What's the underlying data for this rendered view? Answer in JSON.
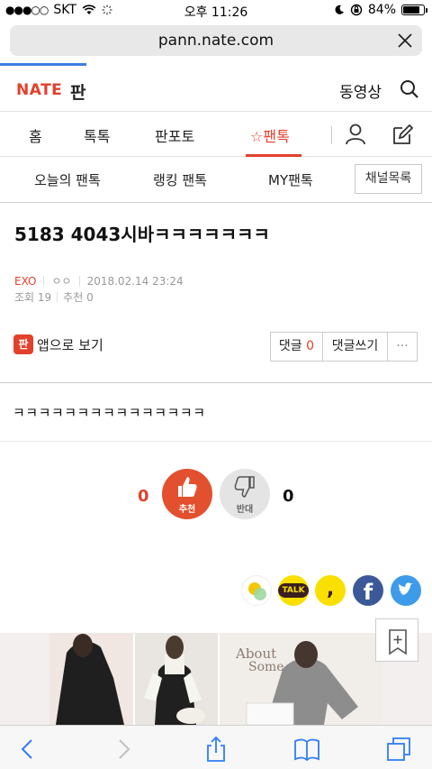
{
  "status": {
    "carrier": "SKT",
    "time": "오후 11:26",
    "battery": "84%",
    "battery_level": 0.84
  },
  "browser": {
    "url": "pann.nate.com",
    "load_progress": 0.2
  },
  "header": {
    "logo": "NATE",
    "section": "판",
    "video": "동영상"
  },
  "nav": {
    "items": [
      "홈",
      "톡톡",
      "판포토",
      "☆팬톡"
    ]
  },
  "subnav": {
    "items": [
      "오늘의 팬톡",
      "랭킹 팬톡",
      "MY팬톡"
    ],
    "channel_button": "채널목록"
  },
  "article": {
    "title": "5183 4043시바ㅋㅋㅋㅋㅋㅋㅋ",
    "author": "EXO",
    "nickname": "ㅇㅇ",
    "date": "2018.02.14 23:24",
    "views": "조회 19",
    "recommend": "추천 0",
    "app_badge": "판",
    "app_view": "앱으로 보기",
    "comment_label": "댓글",
    "comment_count": "0",
    "write_comment": "댓글쓰기",
    "more": "···",
    "body": "ㅋㅋㅋㅋㅋㅋㅋㅋㅋㅋㅋㅋㅋㅋㅋ"
  },
  "votes": {
    "up_count": "0",
    "up_label": "추천",
    "down_count": "0",
    "down_label": "반대"
  },
  "share": {
    "kakaotalk": "TALK"
  },
  "banner": {
    "text1": "About",
    "text2": "Some"
  },
  "colors": {
    "accent": "#e3402c",
    "link": "#3a7fe0"
  }
}
